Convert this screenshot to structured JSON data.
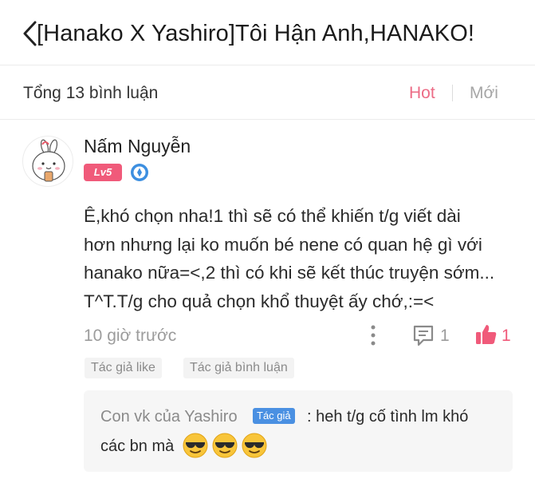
{
  "header": {
    "back_icon": "chevron-left-icon",
    "title": "[Hanako X Yashiro]Tôi Hận Anh,HANAKO!"
  },
  "filter": {
    "total": "Tổng 13 bình luận",
    "hot": "Hot",
    "new": "Mới",
    "active_color": "#ec6c86"
  },
  "comment": {
    "avatar_icon": "bunny-avatar-icon",
    "username": "Nấm Nguyễn",
    "level": "Lv5",
    "level_color": "#f05a7a",
    "verify_icon": "verified-badge-icon",
    "text_lines": [
      "Ê,khó chọn nha!1 thì sẽ có thể khiến t/g viết dài",
      "hơn nhưng lại ko muốn bé nene có quan hệ gì với",
      "hanako nữa=<,2 thì có khi sẽ kết thúc truyện sớm...",
      "T^T.T/g cho quả chọn khổ thuyệt ấy chớ,:=<"
    ],
    "time": "10 giờ trước",
    "more_icon": "more-vertical-icon",
    "reply_icon": "comment-icon",
    "reply_count": "1",
    "like_icon": "thumbs-up-icon",
    "like_count": "1",
    "tags": [
      "Tác giả like",
      "Tác giả bình luận"
    ]
  },
  "reply": {
    "author": "Con vk của Yashiro",
    "author_badge": "Tác giả",
    "badge_color": "#4a90e2",
    "text_line1": ": heh t/g cố tình lm khó",
    "text_line2": "các bn mà",
    "emojis": [
      "sunglasses-emoji-icon",
      "sunglasses-emoji-icon",
      "sunglasses-emoji-icon"
    ]
  }
}
